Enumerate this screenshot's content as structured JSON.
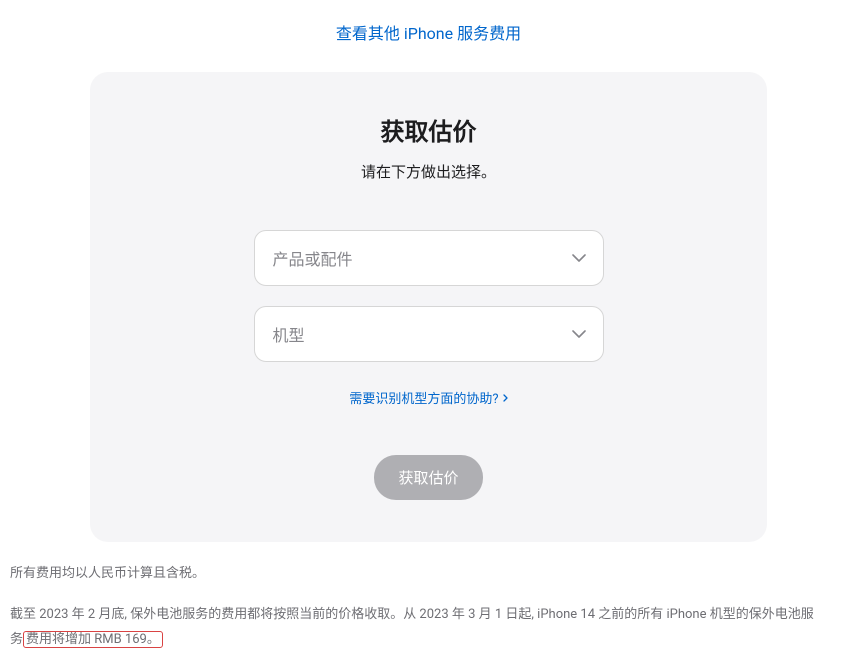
{
  "topLink": "查看其他 iPhone 服务费用",
  "card": {
    "title": "获取估价",
    "subtitle": "请在下方做出选择。",
    "select1": {
      "placeholder": "产品或配件"
    },
    "select2": {
      "placeholder": "机型"
    },
    "helpLink": "需要识别机型方面的协助?",
    "submitButton": "获取估价"
  },
  "footer": {
    "line1": "所有费用均以人民币计算且含税。",
    "line2_part1": "截至 2023 年 2 月底, 保外电池服务的费用都将按照当前的价格收取。从 2023 年 3 月 1 日起, iPhone 14 之前的所有 iPhone 机型的保外电池服",
    "line2_part2_prefix": "务",
    "line2_highlighted": "费用将增加 RMB 169。"
  }
}
